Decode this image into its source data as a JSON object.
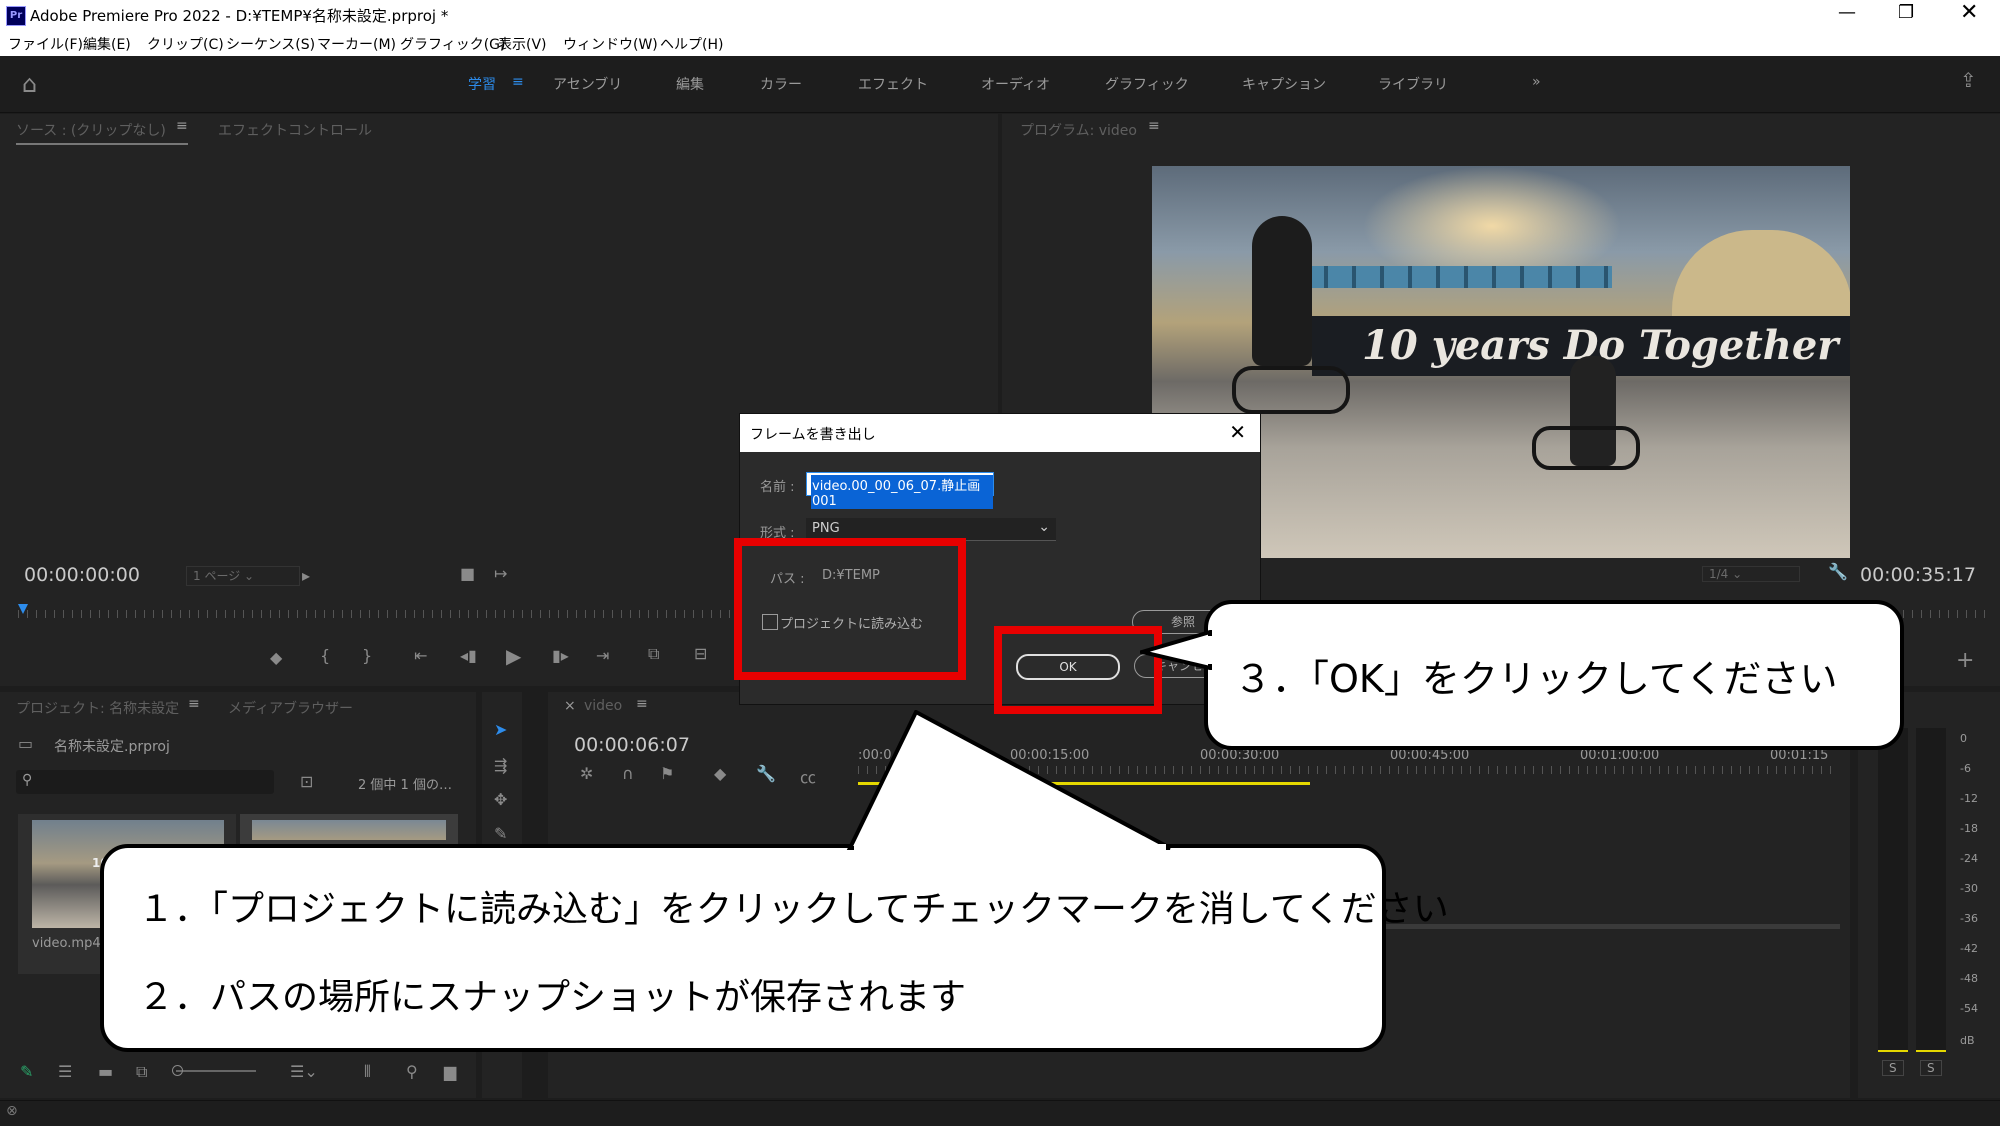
{
  "window": {
    "title": "Adobe Premiere Pro 2022 - D:¥TEMP¥名称未設定.prproj *",
    "app_icon": "Pr"
  },
  "menu": [
    "ファイル(F)",
    "編集(E)",
    "クリップ(C)",
    "シーケンス(S)",
    "マーカー(M)",
    "グラフィック(G)",
    "表示(V)",
    "ウィンドウ(W)",
    "ヘルプ(H)"
  ],
  "workspaces": [
    "学習",
    "アセンブリ",
    "編集",
    "カラー",
    "エフェクト",
    "オーディオ",
    "グラフィック",
    "キャプション",
    "ライブラリ"
  ],
  "source_panel": {
    "tab1": "ソース : (クリップなし)",
    "tab2": "エフェクトコントロール",
    "timecode": "00:00:00:00",
    "page": "1 ページ"
  },
  "program_panel": {
    "tab": "プログラム: video",
    "timecode": "00:00:35:17",
    "zoom": "1/4"
  },
  "project_panel": {
    "tab1": "プロジェクト: 名称未設定",
    "tab2": "メディアブラウザー",
    "file": "名称未設定.prproj",
    "count": "2 個中 1 個の…",
    "clip_name": "video.mp4"
  },
  "timeline": {
    "tab": "video",
    "timecode": "00:00:06:07",
    "ruler": [
      ":00:0",
      "00:00:15:00",
      "00:00:30:00",
      "00:00:45:00",
      "00:01:00:00",
      "00:01:15"
    ]
  },
  "meter_labels": [
    "0",
    "-6",
    "-12",
    "-18",
    "-24",
    "-30",
    "-36",
    "-42",
    "-48",
    "-54",
    "dB"
  ],
  "meter_solo": [
    "S",
    "S"
  ],
  "dialog": {
    "title": "フレームを書き出し",
    "name_label": "名前 :",
    "name_value": "video.00_00_06_07.静止画001",
    "format_label": "形式 :",
    "format_value": "PNG",
    "path_label": "パス :",
    "path_value": "D:¥TEMP",
    "import_label": "プロジェクトに読み込む",
    "browse_label": "参照",
    "ok_label": "OK",
    "cancel_label": "キャンセル"
  },
  "callouts": {
    "step3": "３．「OK」をクリックしてください",
    "step1": "１．「プロジェクトに読み込む」をクリックしてチェックマークを消してください",
    "step2": "２．パスの場所にスナップショットが保存されます"
  },
  "video_overlay_text": "10 years Do Together",
  "thumbnail_overlay_text": "10",
  "colors": {
    "accent": "#2d8ceb",
    "highlight": "#e80000",
    "panel": "#232323",
    "timeline_bar": "#e5d800"
  }
}
